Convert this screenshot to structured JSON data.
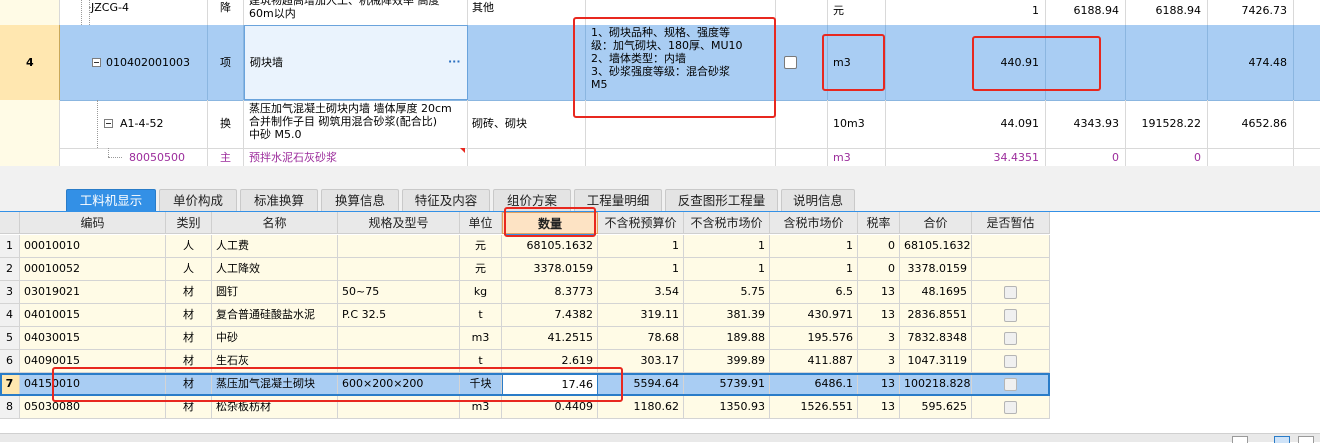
{
  "upper_rows": [
    {
      "index": "",
      "code": "JZCG-4",
      "type": "降",
      "name": "建筑物超高增加人工、机械降效率 高度60m以内",
      "spec": "其他",
      "feature": "",
      "unit": "元",
      "qty": "1",
      "price": "6188.94",
      "total": "6188.94",
      "last": "7426.73"
    },
    {
      "index": "4",
      "code": "010402001003",
      "type": "项",
      "name": "砌块墙",
      "ellipsis": "···",
      "spec": "",
      "feature_lines": [
        "1、砌块品种、规格、强度等",
        "级：加气砌块、180厚、MU10",
        "2、墙体类型：内墙",
        "3、砂浆强度等级：混合砂浆",
        "M5"
      ],
      "unit": "m3",
      "qty": "440.91",
      "price": "",
      "total": "",
      "last": "474.48"
    },
    {
      "index": "",
      "code": "A1-4-52",
      "type": "换",
      "name_lines": [
        "蒸压加气混凝土砌块内墙 墙体厚度 20cm",
        " 合并制作子目 砌筑用混合砂浆(配合比)",
        "中砂 M5.0"
      ],
      "spec": "砌砖、砌块",
      "unit": "10m3",
      "qty": "44.091",
      "price": "4343.93",
      "total": "191528.22",
      "last": "4652.86"
    },
    {
      "index": "",
      "code": "80050500",
      "type": "主",
      "name": "预拌水泥石灰砂浆",
      "unit": "m3",
      "qty": "34.4351",
      "price": "0",
      "total": "0",
      "last": ""
    }
  ],
  "tabs": [
    "工料机显示",
    "单价构成",
    "标准换算",
    "换算信息",
    "特征及内容",
    "组价方案",
    "工程量明细",
    "反查图形工程量",
    "说明信息"
  ],
  "columns": [
    "编码",
    "类别",
    "名称",
    "规格及型号",
    "单位",
    "数量",
    "不含税预算价",
    "不含税市场价",
    "含税市场价",
    "税率",
    "合价",
    "是否暂估"
  ],
  "rows": [
    {
      "n": "1",
      "code": "00010010",
      "cat": "人",
      "name": "人工费",
      "spec": "",
      "unit": "元",
      "qty": "68105.1632",
      "budget": "1",
      "market": "1",
      "taxed": "1",
      "rate": "0",
      "total": "68105.1632",
      "est": false
    },
    {
      "n": "2",
      "code": "00010052",
      "cat": "人",
      "name": "人工降效",
      "spec": "",
      "unit": "元",
      "qty": "3378.0159",
      "budget": "1",
      "market": "1",
      "taxed": "1",
      "rate": "0",
      "total": "3378.0159",
      "est": false
    },
    {
      "n": "3",
      "code": "03019021",
      "cat": "材",
      "name": "圆钉",
      "spec": "50~75",
      "unit": "kg",
      "qty": "8.3773",
      "budget": "3.54",
      "market": "5.75",
      "taxed": "6.5",
      "rate": "13",
      "total": "48.1695",
      "est": true
    },
    {
      "n": "4",
      "code": "04010015",
      "cat": "材",
      "name": "复合普通硅酸盐水泥",
      "spec": "P.C 32.5",
      "unit": "t",
      "qty": "7.4382",
      "budget": "319.11",
      "market": "381.39",
      "taxed": "430.971",
      "rate": "13",
      "total": "2836.8551",
      "est": true
    },
    {
      "n": "5",
      "code": "04030015",
      "cat": "材",
      "name": "中砂",
      "spec": "",
      "unit": "m3",
      "qty": "41.2515",
      "budget": "78.68",
      "market": "189.88",
      "taxed": "195.576",
      "rate": "3",
      "total": "7832.8348",
      "est": true
    },
    {
      "n": "6",
      "code": "04090015",
      "cat": "材",
      "name": "生石灰",
      "spec": "",
      "unit": "t",
      "qty": "2.619",
      "budget": "303.17",
      "market": "399.89",
      "taxed": "411.887",
      "rate": "3",
      "total": "1047.3119",
      "est": true
    },
    {
      "n": "7",
      "code": "04150010",
      "cat": "材",
      "name": "蒸压加气混凝土砌块",
      "spec": "600×200×200",
      "unit": "千块",
      "qty": "17.46",
      "budget": "5594.64",
      "market": "5739.91",
      "taxed": "6486.1",
      "rate": "13",
      "total": "100218.8286",
      "est": true
    },
    {
      "n": "8",
      "code": "05030080",
      "cat": "材",
      "name": "松杂板枋材",
      "spec": "",
      "unit": "m3",
      "qty": "0.4409",
      "budget": "1180.62",
      "market": "1350.93",
      "taxed": "1526.551",
      "rate": "13",
      "total": "595.625",
      "est": true
    }
  ],
  "colors": {
    "selected": "#a9cdf3",
    "accent": "#3390e6",
    "red": "#e8281f",
    "purple": "#9c2d9c",
    "pale": "#fffbe6"
  }
}
